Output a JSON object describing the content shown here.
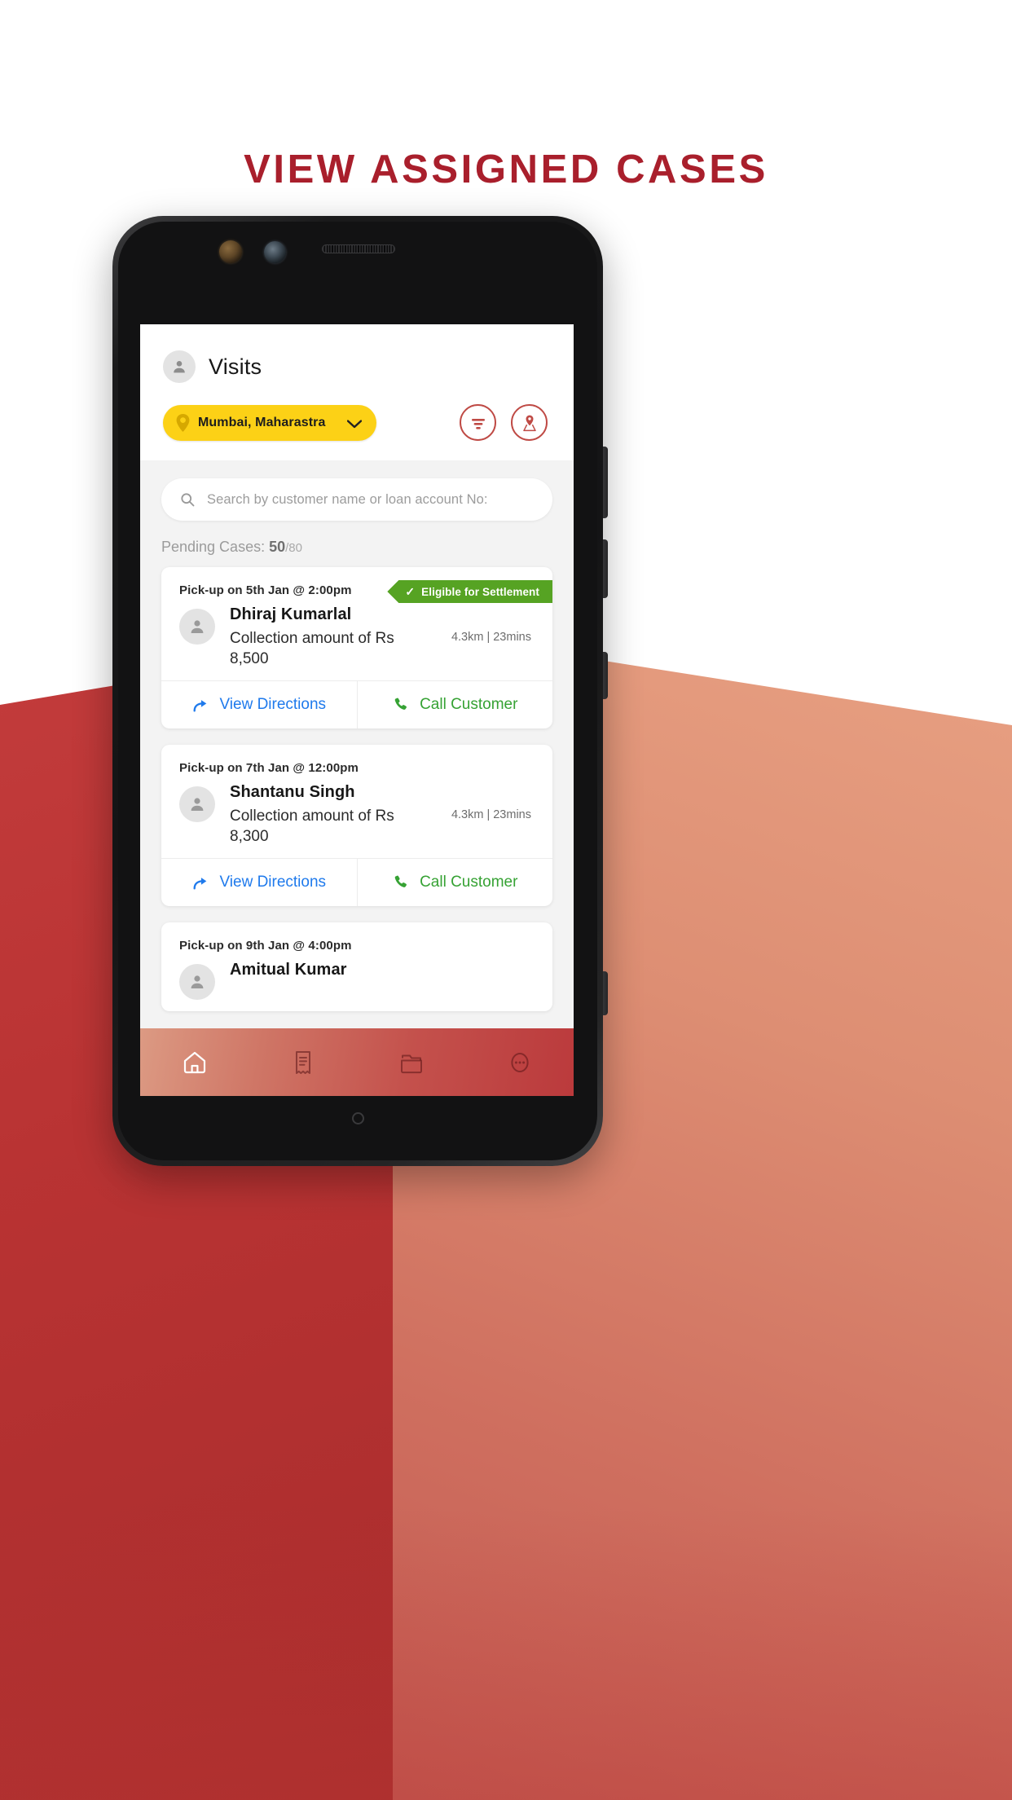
{
  "headline": "VIEW ASSIGNED CASES",
  "colors": {
    "headline_red": "#a91f2c",
    "pill_yellow": "#fcd116",
    "ribbon_green": "#56a323",
    "link_blue": "#1f7aec",
    "call_green": "#36a234",
    "nav_red": "#bb3a3c"
  },
  "app": {
    "header": {
      "avatar_icon": "person-icon",
      "title": "Visits",
      "location_pill": {
        "pin_icon": "map-pin-icon",
        "label": "Mumbai, Maharastra",
        "chevron_icon": "chevron-down-icon"
      },
      "actions": [
        {
          "icon": "filter-icon",
          "name": "filter-button"
        },
        {
          "icon": "map-person-icon",
          "name": "map-view-button"
        }
      ]
    },
    "search": {
      "icon": "search-icon",
      "placeholder": "Search by customer name or loan account No:",
      "value": ""
    },
    "pending": {
      "label": "Pending Cases: ",
      "count": "50",
      "total": "/80"
    },
    "cards": [
      {
        "pickup": "Pick-up on 5th Jan @ 2:00pm",
        "badge": {
          "tick": "✓",
          "label": "Eligible for Settlement",
          "visible": true
        },
        "avatar_icon": "person-icon",
        "name": "Dhiraj Kumarlal",
        "amount": "Collection amount of Rs 8,500",
        "distance": "4.3km | 23mins",
        "actions": {
          "directions_icon": "directions-arrow-icon",
          "directions_label": "View Directions",
          "call_icon": "phone-icon",
          "call_label": "Call Customer"
        }
      },
      {
        "pickup": "Pick-up on 7th Jan @ 12:00pm",
        "badge": {
          "tick": "",
          "label": "",
          "visible": false
        },
        "avatar_icon": "person-icon",
        "name": "Shantanu Singh",
        "amount": "Collection amount of Rs 8,300",
        "distance": "4.3km | 23mins",
        "actions": {
          "directions_icon": "directions-arrow-icon",
          "directions_label": "View Directions",
          "call_icon": "phone-icon",
          "call_label": "Call Customer"
        }
      },
      {
        "pickup": "Pick-up on 9th Jan @ 4:00pm",
        "badge": {
          "tick": "",
          "label": "",
          "visible": false
        },
        "avatar_icon": "person-icon",
        "name": "Amitual Kumar",
        "amount": "",
        "distance": "",
        "actions": {
          "directions_icon": "directions-arrow-icon",
          "directions_label": "",
          "call_icon": "phone-icon",
          "call_label": ""
        }
      }
    ],
    "bottom_nav": [
      {
        "icon": "home-icon",
        "name": "nav-home",
        "active": true
      },
      {
        "icon": "receipt-icon",
        "name": "nav-receipts",
        "active": false
      },
      {
        "icon": "folder-icon",
        "name": "nav-folder",
        "active": false
      },
      {
        "icon": "more-icon",
        "name": "nav-more",
        "active": false
      }
    ]
  }
}
